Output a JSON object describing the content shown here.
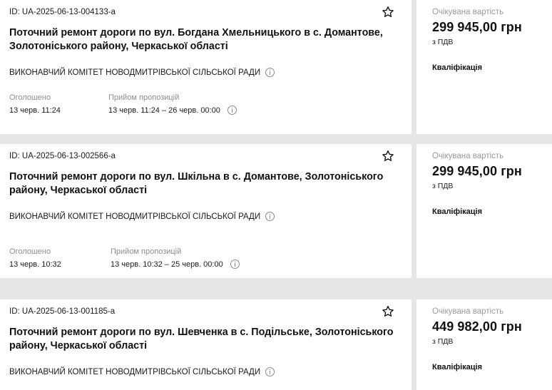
{
  "labels": {
    "announced": "Оголошено",
    "proposals": "Прийом пропозицій",
    "expected_value": "Очікувана вартість",
    "vat": "з ПДВ"
  },
  "tenders": [
    {
      "id": "ID: UA-2025-06-13-004133-a",
      "title": "Поточний ремонт дороги по вул. Богдана Хмельницького в с. Домантове, Золотоніського району, Черкаської області",
      "organization": "ВИКОНАВЧИЙ КОМІТЕТ НОВОДМИТРІВСЬКОЇ СІЛЬСЬКОЇ РАДИ",
      "announced": "13 черв. 11:24",
      "proposals_period": "13 черв. 11:24 – 26 черв. 00:00",
      "price": "299 945,00 грн",
      "procedure": "Кваліфікація"
    },
    {
      "id": "ID: UA-2025-06-13-002566-a",
      "title": "Поточний ремонт дороги по вул. Шкільна в с. Домантове, Золотоніського району, Черкаської області",
      "organization": "ВИКОНАВЧИЙ КОМІТЕТ НОВОДМИТРІВСЬКОЇ СІЛЬСЬКОЇ РАДИ",
      "announced": "13 черв. 10:32",
      "proposals_period": "13 черв. 10:32 – 25 черв. 00:00",
      "price": "299 945,00 грн",
      "procedure": "Кваліфікація"
    },
    {
      "id": "ID: UA-2025-06-13-001185-a",
      "title": "Поточний ремонт дороги по вул. Шевченка в с. Подільське, Золотоніського району, Черкаської області",
      "organization": "ВИКОНАВЧИЙ КОМІТЕТ НОВОДМИТРІВСЬКОЇ СІЛЬСЬКОЇ РАДИ",
      "price": "449 982,00 грн",
      "procedure": "Кваліфікація"
    }
  ]
}
